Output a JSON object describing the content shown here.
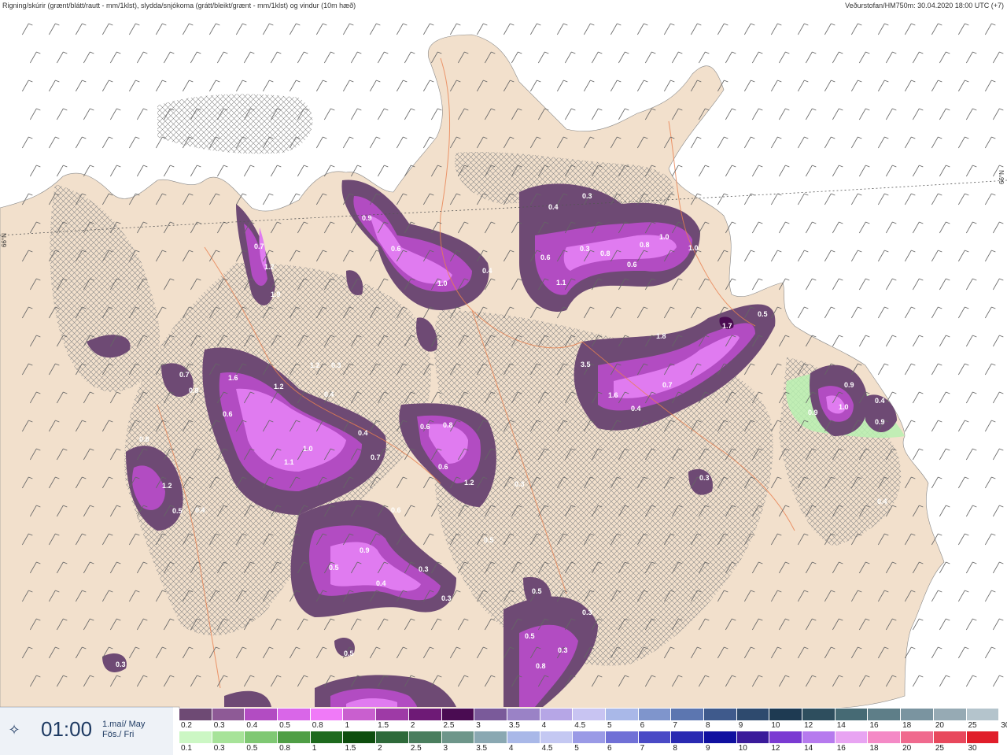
{
  "header": {
    "title": "Rigning/skúrir (grænt/blátt/rautt - mm/1klst), slydda/snjókoma (grátt/bleikt/grænt - mm/1klst) og vindur (10m hæð)",
    "source": "Veðurstofan/HM750m: 30.04.2020 18:00 UTC (+7)"
  },
  "time_panel": {
    "time": "01:00",
    "date_line1": "1.maí/ May",
    "date_line2": "Fös./ Fri"
  },
  "map": {
    "latitude_label": "66°N",
    "colors": {
      "sea": "#ffffff",
      "land": "#f2e0cc",
      "road": "#e8804f",
      "snow_hatch": "#888888",
      "precip_light": "#6e4a74",
      "precip_mid": "#b24cc2",
      "precip_high": "#e07bf0",
      "precip_peak": "#4a0c52",
      "rain_green": "#b9f0b0"
    },
    "value_labels": [
      {
        "text": "0.9"
      },
      {
        "text": "0.6"
      },
      {
        "text": "1.0"
      },
      {
        "text": "0.4"
      },
      {
        "text": "0.3"
      },
      {
        "text": "0.4"
      },
      {
        "text": "0.6"
      },
      {
        "text": "0.3"
      },
      {
        "text": "0.8"
      },
      {
        "text": "0.6"
      },
      {
        "text": "0.8"
      },
      {
        "text": "1.0"
      },
      {
        "text": "1.0"
      },
      {
        "text": "1.1"
      },
      {
        "text": "0.7"
      },
      {
        "text": "1.2"
      },
      {
        "text": "1.9"
      },
      {
        "text": "1.8"
      },
      {
        "text": "1.7"
      },
      {
        "text": "0.5"
      },
      {
        "text": "3.5"
      },
      {
        "text": "1.6"
      },
      {
        "text": "0.4"
      },
      {
        "text": "0.7"
      },
      {
        "text": "0.9"
      },
      {
        "text": "1.0"
      },
      {
        "text": "0.4"
      },
      {
        "text": "0.9"
      },
      {
        "text": "0.9"
      },
      {
        "text": "1.2"
      },
      {
        "text": "1.6"
      },
      {
        "text": "0.6"
      },
      {
        "text": "1.2"
      },
      {
        "text": "0.3"
      },
      {
        "text": "0.4"
      },
      {
        "text": "1.0"
      },
      {
        "text": "1.1"
      },
      {
        "text": "0.7"
      },
      {
        "text": "0.8"
      },
      {
        "text": "0.4"
      },
      {
        "text": "1.2"
      },
      {
        "text": "0.3"
      },
      {
        "text": "0.6"
      },
      {
        "text": "0.8"
      },
      {
        "text": "0.6"
      },
      {
        "text": "0.7"
      },
      {
        "text": "0.6"
      },
      {
        "text": "0.9"
      },
      {
        "text": "0.5"
      },
      {
        "text": "0.4"
      },
      {
        "text": "0.3"
      },
      {
        "text": "0.3"
      },
      {
        "text": "0.5"
      },
      {
        "text": "0.3"
      },
      {
        "text": "0.5"
      },
      {
        "text": "0.8"
      },
      {
        "text": "0.3"
      },
      {
        "text": "0.5"
      },
      {
        "text": "0.3"
      },
      {
        "text": "0.4"
      },
      {
        "text": "0.5"
      },
      {
        "text": "0.3"
      },
      {
        "text": "0.8"
      },
      {
        "text": "1.2"
      },
      {
        "text": "0.5"
      },
      {
        "text": "0.4"
      }
    ]
  },
  "legend": {
    "snow_scale": {
      "labels": [
        "0.2",
        "0.3",
        "0.4",
        "0.5",
        "0.8",
        "1",
        "1.5",
        "2",
        "2.5",
        "3",
        "3.5",
        "4",
        "4.5",
        "5",
        "6",
        "7",
        "8",
        "9",
        "10",
        "12",
        "14",
        "16",
        "18",
        "20",
        "25",
        "30"
      ],
      "colors": [
        "#6e4a74",
        "#8e5a96",
        "#b24cc2",
        "#d966e8",
        "#f07af8",
        "#c95fcf",
        "#9e3aa6",
        "#6e1a76",
        "#4a0c52",
        "#7a5a9a",
        "#9a82c6",
        "#b6a6e6",
        "#c8c4f2",
        "#a9b8e8",
        "#7f95cc",
        "#5c76b0",
        "#3f5a8c",
        "#2e4a6e",
        "#1e3a52",
        "#2e4e5e",
        "#466a74",
        "#5e7e88",
        "#7a94a0",
        "#96aab4",
        "#b4c4cc",
        "#ffffff"
      ]
    },
    "rain_scale": {
      "labels": [
        "0.1",
        "0.3",
        "0.5",
        "0.8",
        "1",
        "1.5",
        "2",
        "2.5",
        "3",
        "3.5",
        "4",
        "4.5",
        "5",
        "6",
        "7",
        "8",
        "9",
        "10",
        "12",
        "14",
        "16",
        "18",
        "20",
        "25",
        "30"
      ],
      "colors": [
        "#ccf7c4",
        "#a7e399",
        "#7fc873",
        "#4f9e45",
        "#1e6a1e",
        "#0e4e0e",
        "#2e6a3a",
        "#4a7e5e",
        "#6e968a",
        "#8aa8b2",
        "#a9b8e8",
        "#c4c8f2",
        "#9a9ae6",
        "#7070d6",
        "#4a4ac6",
        "#2a2ab2",
        "#1010a0",
        "#3a1a9a",
        "#7a3ad2",
        "#b67aee",
        "#e8a4f2",
        "#f48ac6",
        "#f06a8e",
        "#e8485c",
        "#e01e2a"
      ]
    }
  }
}
